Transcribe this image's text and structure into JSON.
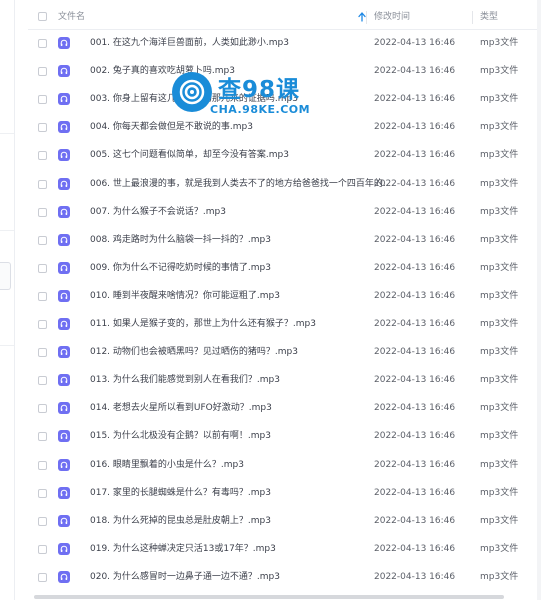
{
  "header": {
    "name_label": "文件名",
    "time_label": "修改时间",
    "type_label": "类型",
    "sort_icon": "arrow-up-icon"
  },
  "watermark": {
    "title": "查98课",
    "url": "CHA.98KE.COM"
  },
  "colors": {
    "file_icon": "#6f6ff2",
    "sort_arrow": "#1e88e5",
    "watermark": "#1a8cd8"
  },
  "files": [
    {
      "name": "001. 在这九个海洋巨兽面前，人类如此渺小.mp3",
      "time": "2022-04-13 16:46",
      "type": "mp3文件"
    },
    {
      "name": "002. 兔子真的喜欢吃胡萝卜吗.mp3",
      "time": "2022-04-13 16:46",
      "type": "mp3文件"
    },
    {
      "name": "003. 你身上留有这几个从动物那儿来的证据吗.mp3",
      "time": "2022-04-13 16:46",
      "type": "mp3文件"
    },
    {
      "name": "004. 你每天都会做但是不敢说的事.mp3",
      "time": "2022-04-13 16:46",
      "type": "mp3文件"
    },
    {
      "name": "005. 这七个问题看似简单，却至今没有答案.mp3",
      "time": "2022-04-13 16:46",
      "type": "mp3文件"
    },
    {
      "name": "006. 世上最浪漫的事，就是我到人类去不了的地方给爸爸找一个四百年的...",
      "time": "2022-04-13 16:46",
      "type": "mp3文件"
    },
    {
      "name": "007. 为什么猴子不会说话？.mp3",
      "time": "2022-04-13 16:46",
      "type": "mp3文件"
    },
    {
      "name": "008. 鸡走路时为什么脑袋一抖一抖的？.mp3",
      "time": "2022-04-13 16:46",
      "type": "mp3文件"
    },
    {
      "name": "009. 你为什么不记得吃奶时候的事情了.mp3",
      "time": "2022-04-13 16:46",
      "type": "mp3文件"
    },
    {
      "name": "010. 睡到半夜醒来啥情况？你可能逗粗了.mp3",
      "time": "2022-04-13 16:46",
      "type": "mp3文件"
    },
    {
      "name": "011. 如果人是猴子变的，那世上为什么还有猴子？.mp3",
      "time": "2022-04-13 16:46",
      "type": "mp3文件"
    },
    {
      "name": "012. 动物们也会被晒黑吗？见过晒伤的猪吗？.mp3",
      "time": "2022-04-13 16:46",
      "type": "mp3文件"
    },
    {
      "name": "013. 为什么我们能感觉到别人在看我们？.mp3",
      "time": "2022-04-13 16:46",
      "type": "mp3文件"
    },
    {
      "name": "014. 老想去火星所以看到UFO好激动？.mp3",
      "time": "2022-04-13 16:46",
      "type": "mp3文件"
    },
    {
      "name": "015. 为什么北极没有企鹅？以前有啊！.mp3",
      "time": "2022-04-13 16:46",
      "type": "mp3文件"
    },
    {
      "name": "016. 眼睛里飘着的小虫是什么？.mp3",
      "time": "2022-04-13 16:46",
      "type": "mp3文件"
    },
    {
      "name": "017. 家里的长腿蜘蛛是什么？有毒吗？.mp3",
      "time": "2022-04-13 16:46",
      "type": "mp3文件"
    },
    {
      "name": "018. 为什么死掉的昆虫总是肚皮朝上？.mp3",
      "time": "2022-04-13 16:46",
      "type": "mp3文件"
    },
    {
      "name": "019. 为什么这种蝉决定只活13或17年？.mp3",
      "time": "2022-04-13 16:46",
      "type": "mp3文件"
    },
    {
      "name": "020. 为什么感冒时一边鼻子通一边不通？.mp3",
      "time": "2022-04-13 16:46",
      "type": "mp3文件"
    }
  ]
}
